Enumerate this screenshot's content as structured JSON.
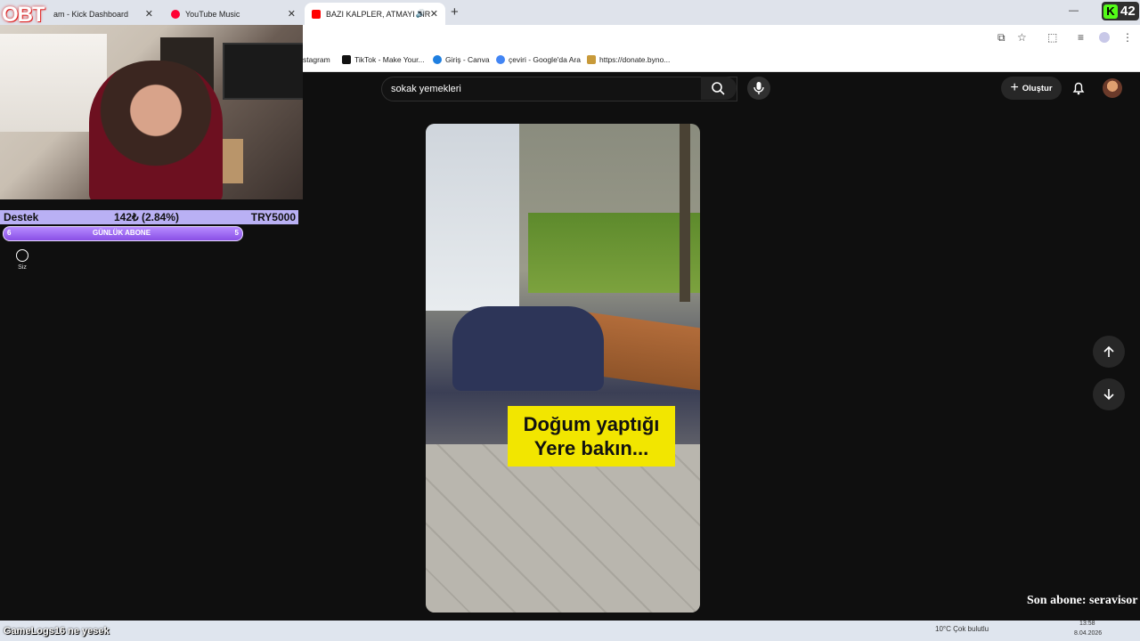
{
  "browser": {
    "tabs": [
      {
        "label": "am - Kick Dashboard",
        "color": "#53fc18"
      },
      {
        "label": "YouTube Music",
        "color": "#ff0033"
      },
      {
        "label": "BAZI KALPLER, ATMAYI BIR",
        "color": "#ff0000"
      }
    ],
    "bookmarks": [
      {
        "label": "stagram"
      },
      {
        "label": "TikTok - Make Your..."
      },
      {
        "label": "Giriş - Canva"
      },
      {
        "label": "çeviri - Google'da Ara"
      },
      {
        "label": "https://donate.byno..."
      }
    ]
  },
  "overlay": {
    "logo": "OBT",
    "donation": {
      "label": "Destek",
      "amount": "142₺ (2.84%)",
      "goal": "TRY5000"
    },
    "sub_goal": {
      "left": "6",
      "label": "GÜNLÜK ABONE",
      "right": "5"
    },
    "last_sub": "Son abone: seravisor",
    "chat": {
      "user": "GameLogs16",
      "message": "ne yesek"
    },
    "kick_viewers": "42"
  },
  "youtube": {
    "sidebar_you": "Siz",
    "search_value": "sokak yemekleri",
    "create_label": "Oluştur",
    "video_caption_line1": "Doğum yaptığı",
    "video_caption_line2": "Yere bakın..."
  },
  "taskbar": {
    "time": "13:58",
    "date": "8.04.2026",
    "weather": "10°C  Çok bulutlu"
  }
}
